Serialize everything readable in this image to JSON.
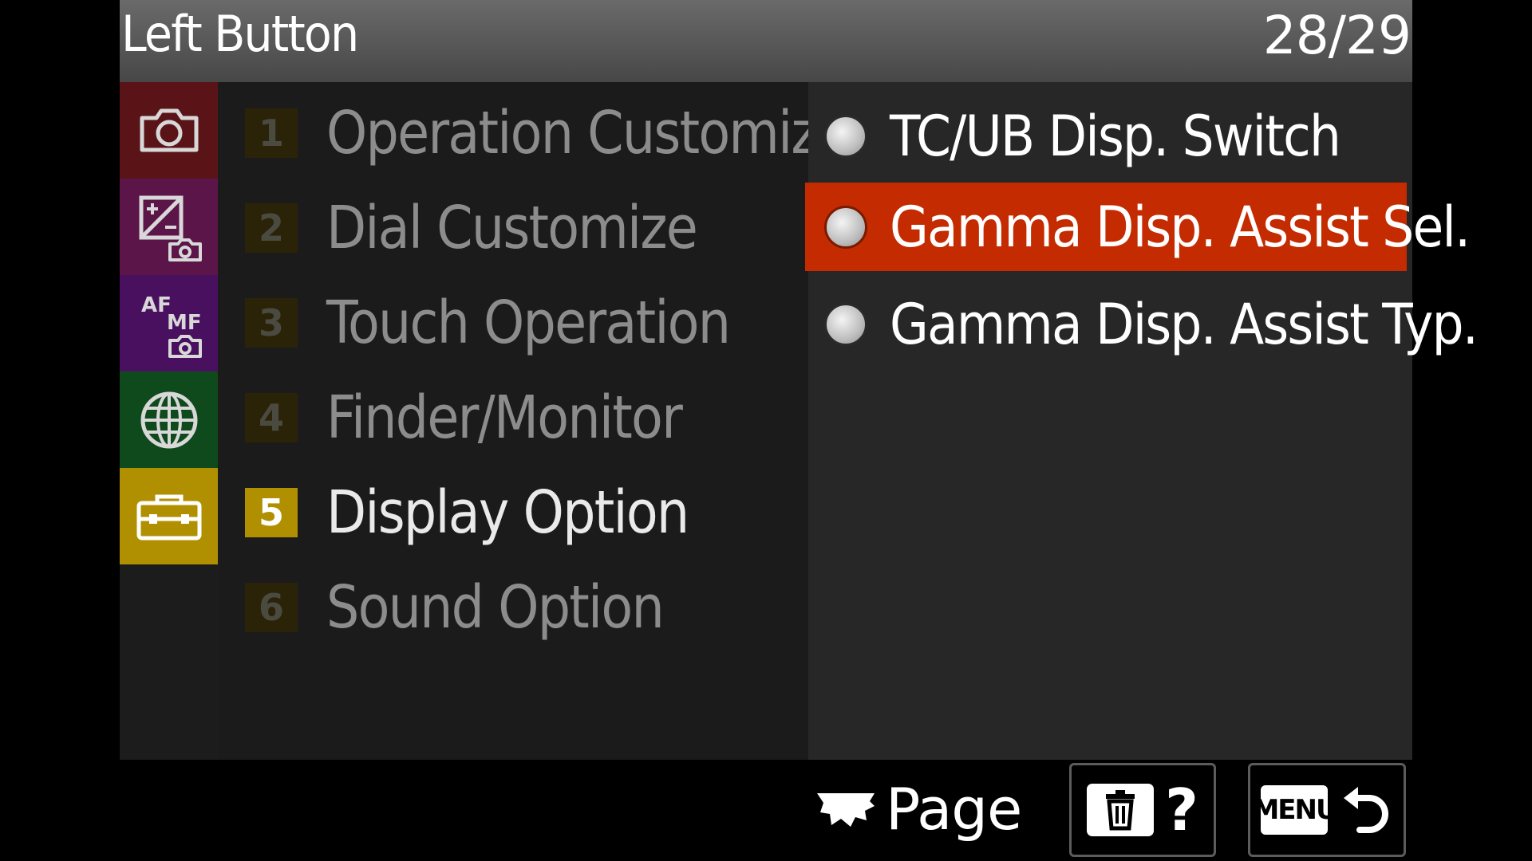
{
  "header": {
    "title": "Left Button",
    "page_indicator": "28/29"
  },
  "tabs": [
    {
      "name": "camera-icon",
      "color": "#5a1418"
    },
    {
      "name": "exposure-camera-icon",
      "color": "#5b1548"
    },
    {
      "name": "af-mf-camera-icon",
      "color": "#4a1060"
    },
    {
      "name": "network-globe-icon",
      "color": "#0f4a1c"
    },
    {
      "name": "toolbox-icon",
      "color": "#b09000",
      "active": true
    }
  ],
  "categories": [
    {
      "number": "1",
      "label": "Operation Customize"
    },
    {
      "number": "2",
      "label": "Dial Customize"
    },
    {
      "number": "3",
      "label": "Touch Operation"
    },
    {
      "number": "4",
      "label": "Finder/Monitor"
    },
    {
      "number": "5",
      "label": "Display Option",
      "active": true
    },
    {
      "number": "6",
      "label": "Sound Option"
    }
  ],
  "options": [
    {
      "label": "TC/UB Disp. Switch"
    },
    {
      "label": "Gamma Disp. Assist Sel.",
      "selected": true
    },
    {
      "label": "Gamma Disp. Assist Typ."
    }
  ],
  "footer": {
    "page_label": "Page",
    "help_label": "?",
    "menu_label": "MENU"
  },
  "colors": {
    "selected_option_bg": "#c52b00",
    "active_category_badge": "#b09000"
  }
}
